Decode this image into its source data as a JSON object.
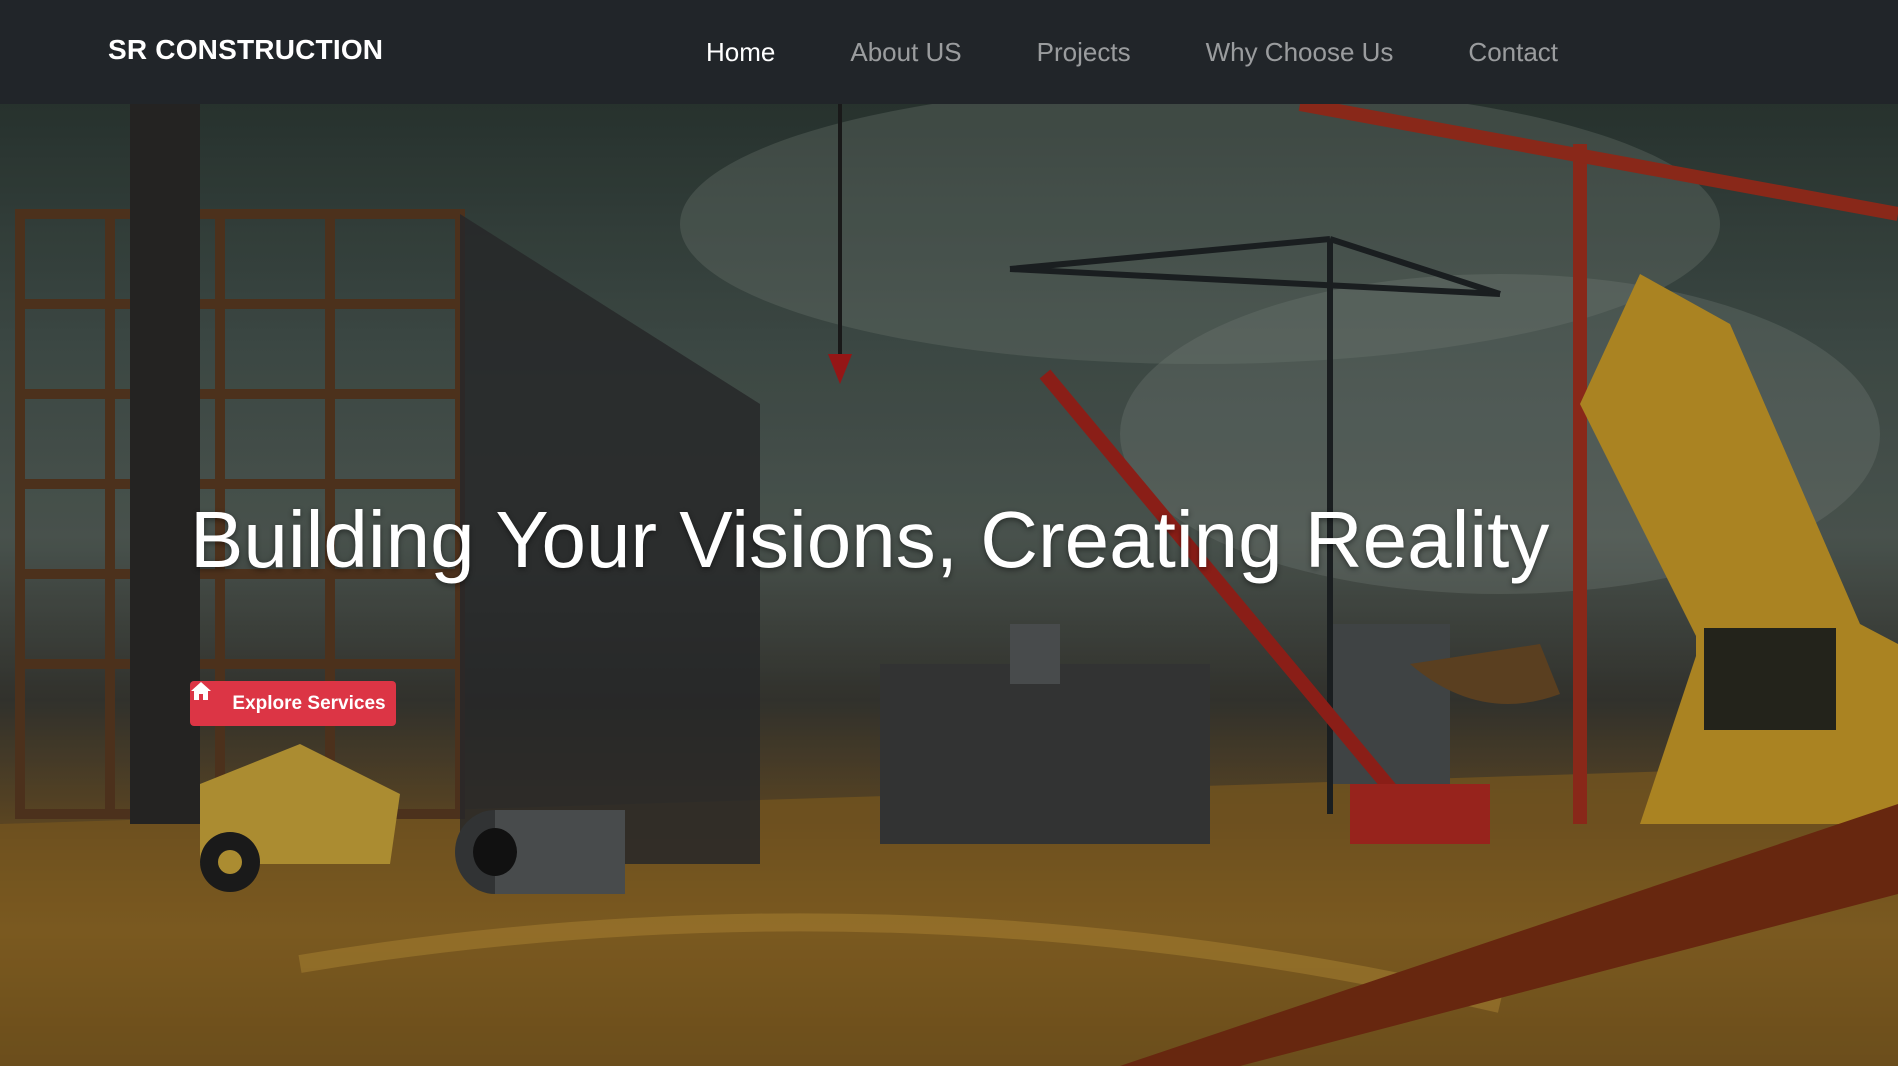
{
  "navbar": {
    "brand": "SR CONSTRUCTION",
    "links": [
      {
        "label": "Home",
        "active": true
      },
      {
        "label": "About US",
        "active": false
      },
      {
        "label": "Projects",
        "active": false
      },
      {
        "label": "Why Choose Us",
        "active": false
      },
      {
        "label": "Contact",
        "active": false
      }
    ]
  },
  "hero": {
    "title": "Building Your Visions, Creating Reality",
    "button_label": "Explore Services",
    "button_icon": "home-icon"
  },
  "colors": {
    "navbar_bg": "#212529",
    "accent": "#dc3545"
  }
}
